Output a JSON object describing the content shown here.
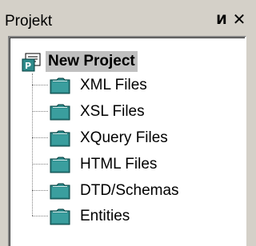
{
  "panel": {
    "title": "Projekt",
    "pin_glyph": "И",
    "close_glyph": "✕"
  },
  "tree": {
    "root": {
      "label": "New Project",
      "icon": "project-icon"
    },
    "items": [
      {
        "label": "XML Files",
        "icon": "folder-icon"
      },
      {
        "label": "XSL Files",
        "icon": "folder-icon"
      },
      {
        "label": "XQuery Files",
        "icon": "folder-icon"
      },
      {
        "label": "HTML Files",
        "icon": "folder-icon"
      },
      {
        "label": "DTD/Schemas",
        "icon": "folder-icon"
      },
      {
        "label": "Entities",
        "icon": "folder-icon"
      }
    ]
  },
  "colors": {
    "window_bg": "#d4d0c8",
    "tree_bg": "#ffffff",
    "root_highlight": "#c0c0c0",
    "folder_teal": "#2f8a8a"
  }
}
